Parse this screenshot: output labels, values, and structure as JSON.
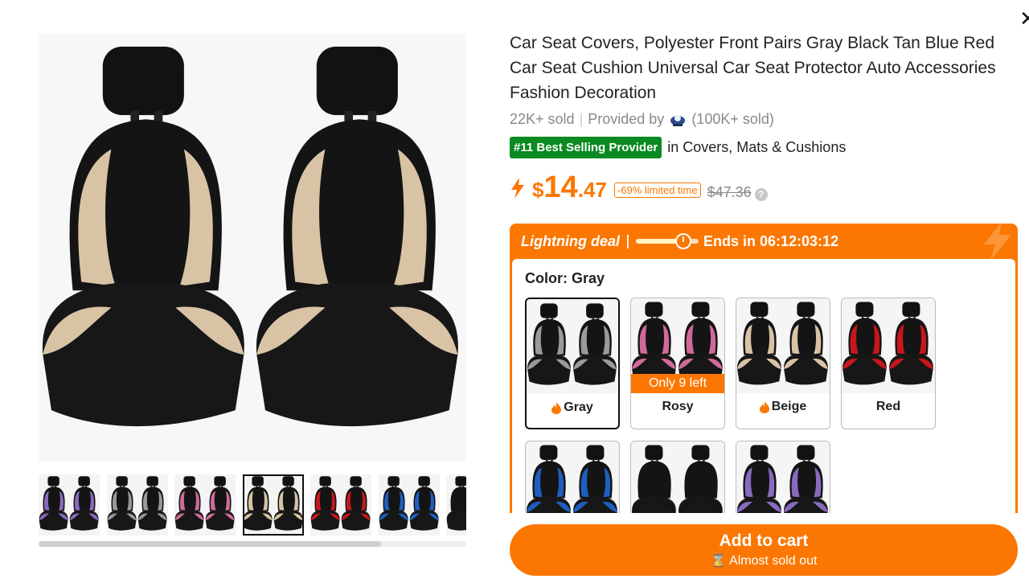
{
  "product": {
    "title": "Car Seat Covers, Polyester Front Pairs Gray Black Tan Blue Red Car Seat Cushion Universal Car Seat Protector Auto Accessories Fashion Decoration",
    "sold": "22K+ sold",
    "provided_by": "Provided by",
    "provider_sold": "(100K+ sold)",
    "rank_badge": "#11 Best Selling Provider",
    "rank_category": "in Covers, Mats & Cushions"
  },
  "price": {
    "currency": "$",
    "integer": "14",
    "decimal": ".47",
    "discount": "-69% limited time",
    "original": "$47.36",
    "accent": "#fb7701"
  },
  "deal": {
    "title": "Lightning deal",
    "ends": "Ends in 06:12:03:12",
    "progress": 0.75
  },
  "color": {
    "label": "Color: Gray",
    "options": [
      {
        "name": "Gray",
        "accent": "#9a9a9a",
        "hot": true,
        "stock": "",
        "selected": true
      },
      {
        "name": "Rosy",
        "accent": "#d06a9a",
        "hot": false,
        "stock": "Only 9 left",
        "selected": false
      },
      {
        "name": "Beige",
        "accent": "#d8c3a5",
        "hot": true,
        "stock": "",
        "selected": false
      },
      {
        "name": "Red",
        "accent": "#c8161d",
        "hot": false,
        "stock": "",
        "selected": false
      },
      {
        "name": "",
        "accent": "#1f5fbf",
        "hot": false,
        "stock": "",
        "selected": false
      },
      {
        "name": "",
        "accent": "#141414",
        "hot": false,
        "stock": "",
        "selected": false
      },
      {
        "name": "",
        "accent": "#8a6ac0",
        "hot": false,
        "stock": "",
        "selected": false
      }
    ]
  },
  "gallery": {
    "main_accent": "#d8c3a5",
    "thumbnails": [
      {
        "accent": "#8a6ac0",
        "selected": false
      },
      {
        "accent": "#9a9a9a",
        "selected": false
      },
      {
        "accent": "#d06a9a",
        "selected": false
      },
      {
        "accent": "#d8c3a5",
        "selected": true
      },
      {
        "accent": "#c8161d",
        "selected": false
      },
      {
        "accent": "#1f5fbf",
        "selected": false
      },
      {
        "accent": "#141414",
        "selected": false
      }
    ],
    "scroll_fraction": 0.8
  },
  "cart": {
    "label": "Add to cart",
    "sublabel": "⌛ Almost sold out"
  },
  "icons": {
    "close": "close-icon",
    "bolt": "lightning-bolt-icon",
    "flame": "flame-icon",
    "help": "question-icon",
    "provider": "provider-logo-icon"
  }
}
